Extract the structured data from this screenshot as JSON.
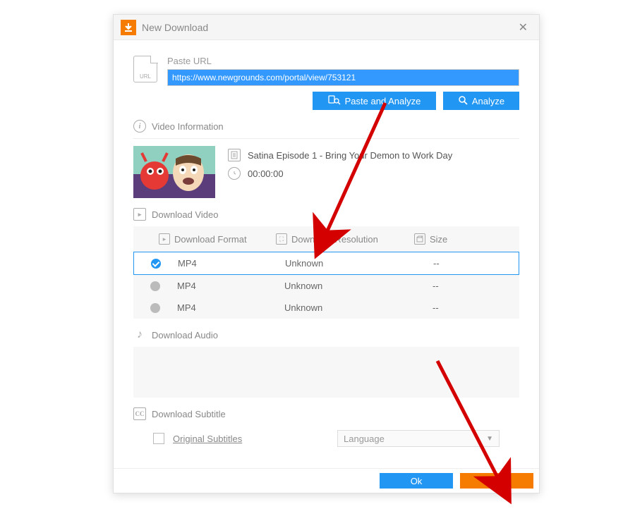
{
  "dialog": {
    "title": "New Download"
  },
  "urlSection": {
    "label": "Paste URL",
    "iconText": "URL",
    "value": "https://www.newgrounds.com/portal/view/753121",
    "pasteAnalyze": "Paste and Analyze",
    "analyze": "Analyze"
  },
  "videoInfo": {
    "header": "Video Information",
    "title": "Satina Episode 1 - Bring Your Demon to Work Day",
    "duration": "00:00:00"
  },
  "downloadVideo": {
    "header": "Download Video",
    "columns": {
      "format": "Download Format",
      "resolution": "Download Resolution",
      "size": "Size"
    },
    "rows": [
      {
        "format": "MP4",
        "resolution": "Unknown",
        "size": "--",
        "selected": true
      },
      {
        "format": "MP4",
        "resolution": "Unknown",
        "size": "--",
        "selected": false
      },
      {
        "format": "MP4",
        "resolution": "Unknown",
        "size": "--",
        "selected": false
      }
    ]
  },
  "downloadAudio": {
    "header": "Download Audio"
  },
  "downloadSubtitle": {
    "header": "Download Subtitle",
    "originalLabel": "Original Subtitles",
    "languageLabel": "Language"
  },
  "footer": {
    "ok": "Ok",
    "cancel": "Cancel"
  }
}
